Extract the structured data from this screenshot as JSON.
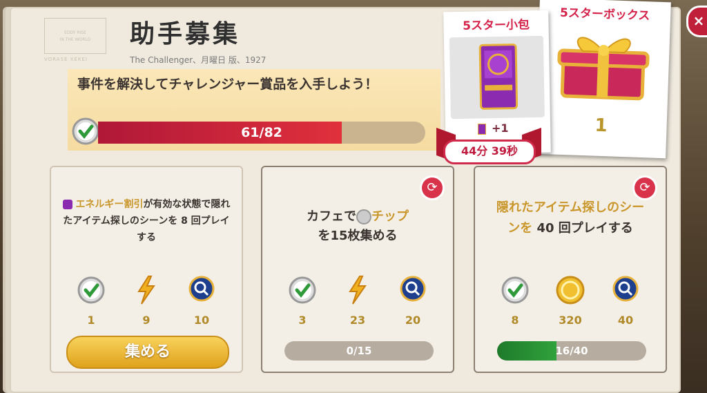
{
  "header": {
    "title": "助手募集",
    "subtitle": "The Challenger、月曜日 版、1927",
    "stamp_line1": "EDDY RISE",
    "stamp_line2": "IN THE WORLD",
    "stamp_footer": "VORASE XEKEI"
  },
  "objective": {
    "text": "事件を解決してチャレンジャー賞品を入手しよう！",
    "progress_label": "61/82",
    "progress_current": 61,
    "progress_total": 82
  },
  "rewards": {
    "pack": {
      "title": "5スター小包",
      "bonus": "+1",
      "timer": "44分 39秒"
    },
    "box": {
      "title": "5スターボックス",
      "quantity": "1"
    }
  },
  "close_label": "×",
  "tasks": [
    {
      "highlight": "エネルギー割引",
      "text_rest": "が有効な状態で隠れたアイテム探しのシーンを 8 回プレイする",
      "rewards": [
        "1",
        "9",
        "10"
      ],
      "button_label": "集める"
    },
    {
      "text_a": "カフェで",
      "highlight": "チップ",
      "text_b": "を15枚集める",
      "rewards": [
        "3",
        "23",
        "20"
      ],
      "progress_label": "0/15",
      "progress_fraction": 0.0
    },
    {
      "highlight": "隠れたアイテム探しのシーンを",
      "text_rest": " 40 回プレイする",
      "rewards": [
        "8",
        "320",
        "40"
      ],
      "progress_label": "16/40",
      "progress_fraction": 0.4
    }
  ],
  "colors": {
    "accent_red": "#d02a4a",
    "gold": "#c9962b",
    "green": "#30a23c"
  }
}
